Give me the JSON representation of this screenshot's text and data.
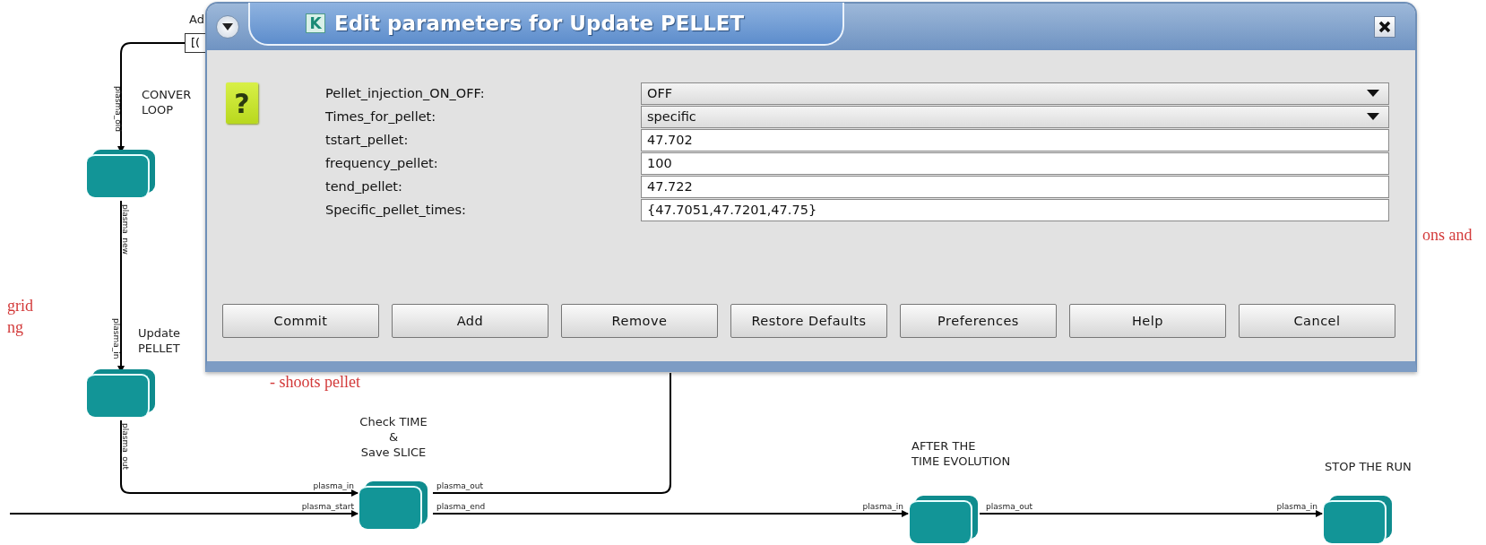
{
  "canvas": {
    "parameter_box": {
      "title": "Ad",
      "value": "[("
    },
    "actors": [
      {
        "label": [
          "CONVER",
          "LOOP"
        ]
      },
      {
        "label": [
          "Update",
          "PELLET"
        ]
      },
      {
        "label": [
          "Check TIME",
          "&",
          "Save SLICE"
        ]
      },
      {
        "label": [
          "AFTER THE",
          "TIME EVOLUTION"
        ]
      },
      {
        "label": [
          "STOP THE RUN"
        ]
      }
    ],
    "port_labels": [
      "plasma_old",
      "plasma_new",
      "plasma_in",
      "plasma_out",
      "plasma_in",
      "plasma_out",
      "plasma_start",
      "plasma_end",
      "plasma_in",
      "plasma_out",
      "plasma_in"
    ],
    "annotations": [
      "grid",
      "ng",
      "- shoots pellet",
      "ons and"
    ]
  },
  "dialog": {
    "title": "Edit parameters for Update PELLET",
    "logo_letter": "K",
    "icon_glyph": "?",
    "parameters": [
      {
        "name": "Pellet_injection_ON_OFF:",
        "kind": "dropdown",
        "value": "OFF"
      },
      {
        "name": "Times_for_pellet:",
        "kind": "dropdown",
        "value": "specific"
      },
      {
        "name": "tstart_pellet:",
        "kind": "text",
        "value": "47.702"
      },
      {
        "name": "frequency_pellet:",
        "kind": "text",
        "value": "100"
      },
      {
        "name": "tend_pellet:",
        "kind": "text",
        "value": "47.722"
      },
      {
        "name": "Specific_pellet_times:",
        "kind": "text",
        "value": "{47.7051,47.7201,47.75}"
      }
    ],
    "buttons": [
      "Commit",
      "Add",
      "Remove",
      "Restore Defaults",
      "Preferences",
      "Help",
      "Cancel"
    ]
  }
}
